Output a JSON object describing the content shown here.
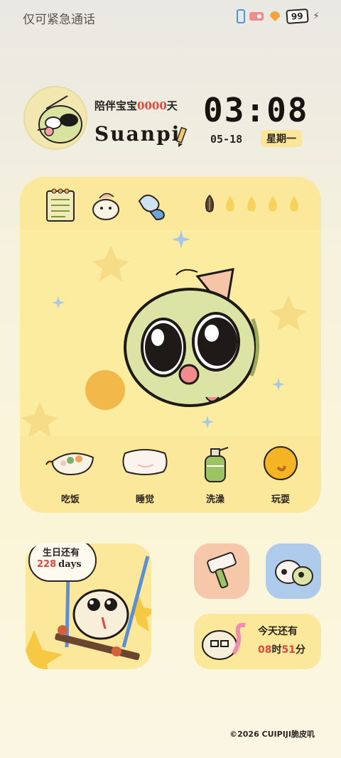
{
  "status_bar": {
    "carrier": "仅可紧急通话",
    "battery": "99",
    "icons": [
      "nfc-icon",
      "sim-icon",
      "wifi-icon",
      "battery-icon",
      "charging-icon"
    ]
  },
  "header": {
    "title_prefix": "陪伴宝宝",
    "days_count": "0000",
    "title_suffix": "天",
    "pet_name": "Suanpi",
    "time": "03:08",
    "date": "05-18",
    "weekday": "星期一"
  },
  "main_card": {
    "top_icons": [
      "notebook-icon",
      "pet-bath-icon",
      "wave-icon",
      "seed-icon"
    ],
    "food_drops": 4,
    "actions": [
      {
        "label": "吃饭",
        "icon": "food-bowl-icon"
      },
      {
        "label": "睡觉",
        "icon": "pillow-icon"
      },
      {
        "label": "洗澡",
        "icon": "shampoo-icon"
      },
      {
        "label": "玩耍",
        "icon": "ball-icon"
      }
    ]
  },
  "birthday": {
    "line1": "生日还有",
    "days": "228",
    "unit": "days"
  },
  "countdown": {
    "title": "今天还有",
    "hours": "08",
    "hours_unit": "时",
    "minutes": "51",
    "minutes_unit": "分"
  },
  "footer": {
    "copyright": "©2026 CUIPIJI脆皮叽"
  },
  "colors": {
    "card": "#fbe89a",
    "accent_red": "#e0463c",
    "peach": "#f6c7a8",
    "blue": "#aecbeb"
  }
}
